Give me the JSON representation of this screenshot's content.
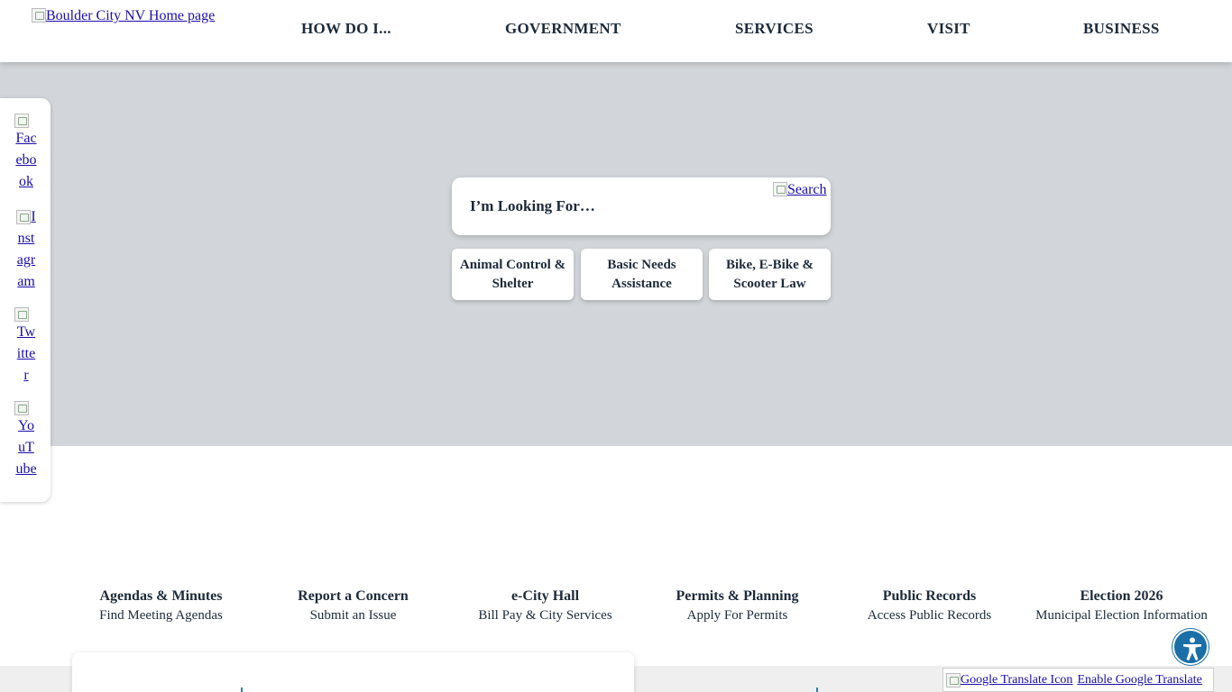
{
  "header": {
    "logo_alt": "Boulder City NV Home page",
    "nav": [
      "HOW DO I...",
      "GOVERNMENT",
      "SERVICES",
      "VISIT",
      "BUSINESS"
    ]
  },
  "social": [
    {
      "alt": "Facebook",
      "lines": [
        "Fac",
        "ebo",
        "ok"
      ]
    },
    {
      "alt": "Instagram",
      "lines": [
        "I",
        "nst",
        "agr",
        "am"
      ]
    },
    {
      "alt": "Twitter",
      "lines": [
        "Tw",
        "itte",
        "r"
      ]
    },
    {
      "alt": "YouTube",
      "lines": [
        "Yo",
        "uT",
        "ube"
      ]
    }
  ],
  "search": {
    "placeholder": "I’m Looking For…",
    "button_alt": "Search"
  },
  "quick_buttons": [
    {
      "label": "Animal Control & Shelter"
    },
    {
      "label": "Basic Needs Assistance"
    },
    {
      "label": "Bike, E-Bike & Scooter Law"
    }
  ],
  "quick_links": [
    {
      "title": "Agendas & Minutes",
      "sub": "Find Meeting Agendas"
    },
    {
      "title": "Report a Concern",
      "sub": "Submit an Issue"
    },
    {
      "title": "e-City Hall",
      "sub": "Bill Pay & City Services"
    },
    {
      "title": "Permits & Planning",
      "sub": "Apply For Permits"
    },
    {
      "title": "Public Records",
      "sub": "Access Public Records"
    },
    {
      "title": "Election 2026",
      "sub": "Municipal Election Information"
    }
  ],
  "translate": {
    "icon_alt": "Google Translate Icon",
    "label": "Enable Google Translate"
  },
  "colors": {
    "hero_bg": "#d2d5d9",
    "text": "#1d2a3a",
    "link": "#1a0dab",
    "accessibility": "#1b6fa8"
  },
  "icons": {
    "accessibility": "accessibility-person-icon"
  }
}
